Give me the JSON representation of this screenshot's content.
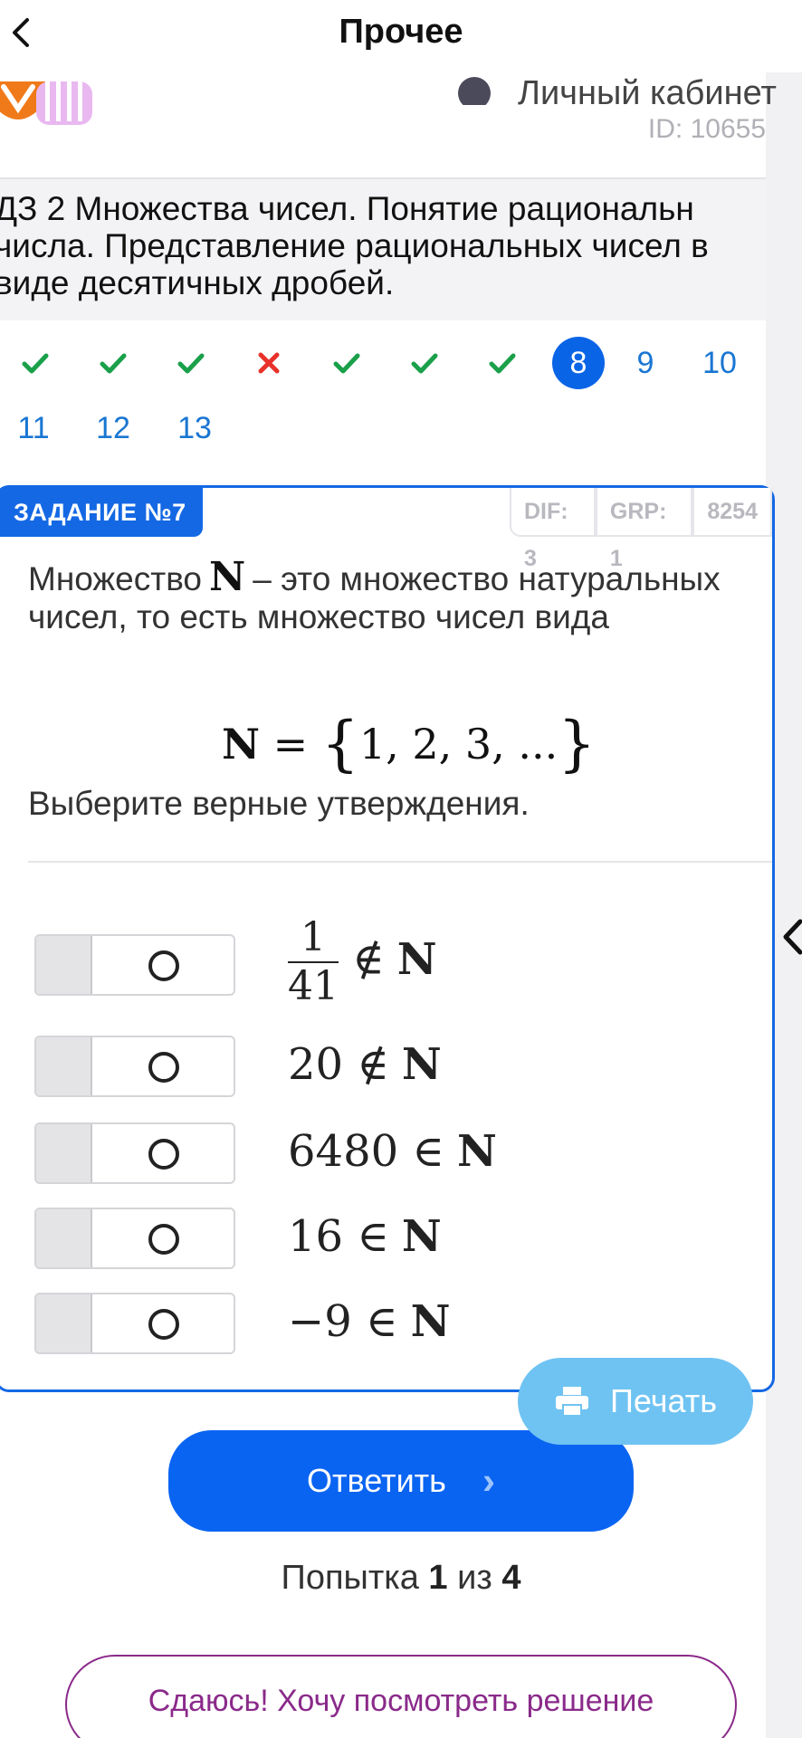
{
  "header": {
    "title": "Прочее"
  },
  "account": {
    "cabinet_label": "Личный кабинет",
    "user_id": "ID: 10655"
  },
  "topic": {
    "lines": [
      "ДЗ 2 Множества чисел. Понятие рациональн",
      "числа. Представление рациональных чисел в",
      "виде десятичных дробей."
    ]
  },
  "questions": {
    "statuses": [
      "correct",
      "correct",
      "correct",
      "wrong",
      "correct",
      "correct",
      "correct"
    ],
    "numbers": [
      "8",
      "9",
      "10",
      "11",
      "12",
      "13"
    ],
    "active": "8"
  },
  "colors": {
    "accent": "#1468e4",
    "correct": "#1aa04a",
    "wrong": "#e8322a",
    "print": "#6fc3f2",
    "giveup": "#8a2a8a"
  },
  "task": {
    "label": "ЗАДАНИЕ №7",
    "tags": [
      "DIF: 3",
      "GRP: 1",
      "8254"
    ],
    "text_before": "Множество",
    "set_symbol": "N",
    "text_after": "– это множество натуральных чисел, то есть множество чисел вида",
    "formula": {
      "lhs": "N",
      "eq": "=",
      "open": "{",
      "values": "1, 2, 3, ...",
      "close": "}"
    },
    "instruction": "Выберите верные утверждения."
  },
  "options": [
    {
      "numerator": "1",
      "denominator": "41",
      "relation": "∉",
      "set": "N"
    },
    {
      "lhs": "20",
      "relation": "∉",
      "set": "N"
    },
    {
      "lhs": "6480",
      "relation": "∈",
      "set": "N"
    },
    {
      "lhs": "16",
      "relation": "∈",
      "set": "N"
    },
    {
      "lhs": "−9",
      "relation": "∈",
      "set": "N"
    }
  ],
  "buttons": {
    "print": "Печать",
    "answer": "Ответить",
    "answer_chevron": "›",
    "giveup": "Сдаюсь! Хочу посмотреть решение"
  },
  "attempt": {
    "prefix": "Попытка",
    "current": "1",
    "middle": "из",
    "total": "4"
  }
}
